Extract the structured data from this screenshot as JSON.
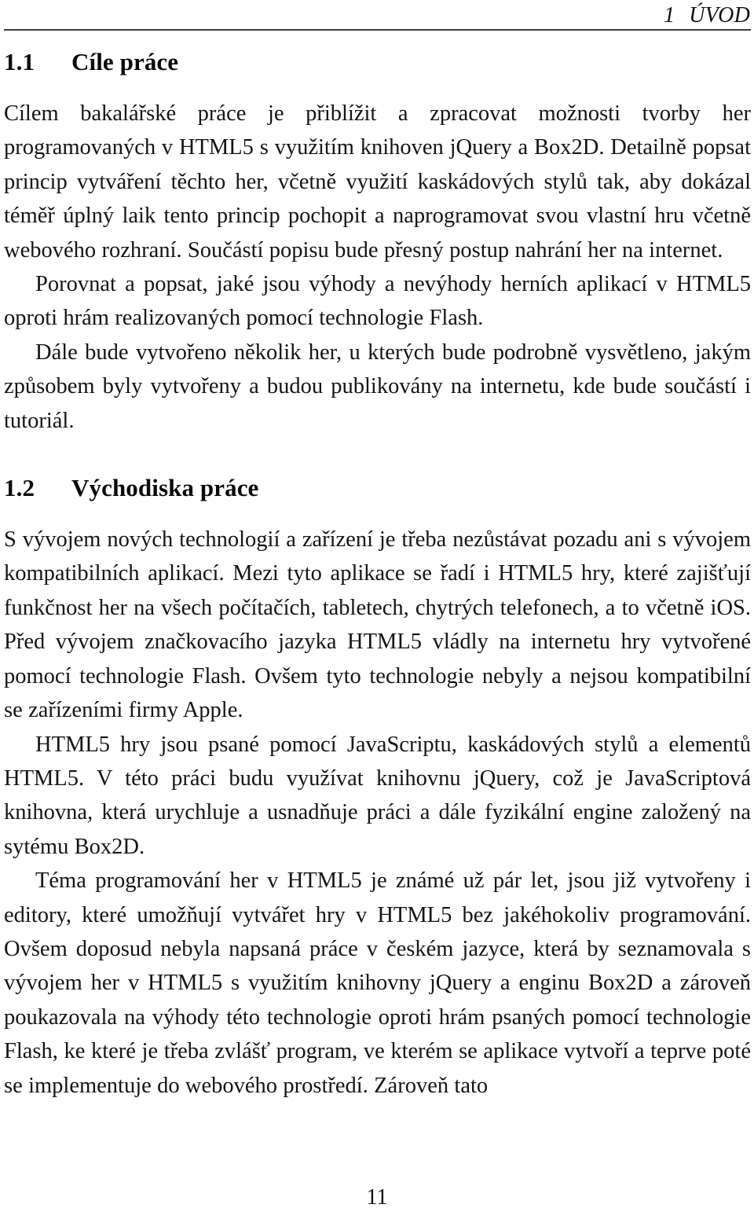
{
  "document": {
    "running_header": {
      "chapter_number": "1",
      "chapter_title": "ÚVOD"
    },
    "page_number": "11",
    "sections": [
      {
        "number": "1.1",
        "title": "Cíle práce",
        "paragraphs": [
          "Cílem bakalářské práce je přiblížit a zpracovat možnosti tvorby her programovaných v HTML5 s využitím knihoven jQuery a Box2D. Detailně popsat princip vytváření těchto her, včetně využití kaskádových stylů tak, aby dokázal téměř úplný laik tento princip pochopit a naprogramovat svou vlastní hru včetně webového rozhraní. Součástí popisu bude přesný postup nahrání her na internet.",
          "Porovnat a popsat, jaké jsou výhody a nevýhody herních aplikací v HTML5 oproti hrám realizovaných pomocí technologie Flash.",
          "Dále bude vytvořeno několik her, u kterých bude podrobně vysvětleno, jakým způsobem byly vytvořeny a budou publikovány na internetu, kde bude součástí i tutoriál."
        ]
      },
      {
        "number": "1.2",
        "title": "Východiska práce",
        "paragraphs": [
          "S vývojem nových technologií a zařízení je třeba nezůstávat pozadu ani s vývojem kompatibilních aplikací. Mezi tyto aplikace se řadí i HTML5 hry, které zajišťují funkčnost her na všech počítačích, tabletech, chytrých telefonech, a to včetně iOS. Před vývojem značkovacího jazyka HTML5 vládly na internetu hry vytvořené pomocí technologie Flash. Ovšem tyto technologie nebyly a nejsou kompatibilní se zařízeními firmy Apple.",
          "HTML5 hry jsou psané pomocí JavaScriptu, kaskádových stylů a elementů HTML5. V této práci budu využívat knihovnu jQuery, což je JavaScriptová knihovna, která urychluje a usnadňuje práci a dále fyzikální engine založený na sytému Box2D.",
          "Téma programování her v HTML5 je známé už pár let, jsou již vytvořeny i editory, které umožňují vytvářet hry v HTML5 bez jakéhokoliv programování. Ovšem doposud nebyla napsaná práce v českém jazyce, která by seznamovala s vývojem her v HTML5 s využitím knihovny jQuery a enginu Box2D a zároveň poukazovala na výhody této technologie oproti hrám psaných pomocí technologie Flash, ke které je třeba zvlášť program, ve kterém se aplikace vytvoří a teprve poté se implementuje do webového prostředí. Zároveň tato"
        ]
      }
    ]
  }
}
